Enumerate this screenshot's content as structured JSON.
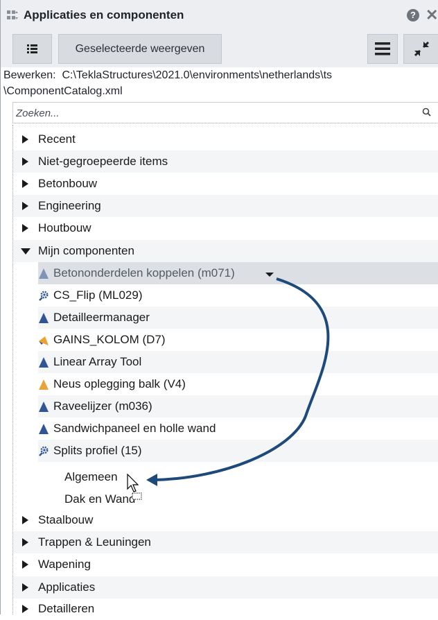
{
  "window": {
    "title": "Applicaties en componenten",
    "help_symbol": "?",
    "close_symbol": "✕"
  },
  "toolbar": {
    "list_icon": "list-icon",
    "selected_button_label": "Geselecteerde weergeven",
    "menu_icon": "hamburger-menu-icon",
    "collapse_icon": "collapse-arrows-icon"
  },
  "catalog_path": {
    "label": "Bewerken:",
    "path_line1": "C:\\TeklaStructures\\2021.0\\environments\\netherlands\\ts",
    "path_line2": "\\ComponentCatalog.xml"
  },
  "search": {
    "placeholder": "Zoeken...",
    "value": ""
  },
  "tree": {
    "groups_top": [
      {
        "label": "Recent"
      },
      {
        "label": "Niet-gegroepeerde items"
      },
      {
        "label": "Betonbouw"
      },
      {
        "label": "Engineering"
      },
      {
        "label": "Houtbouw"
      }
    ],
    "expanded_group": {
      "label": "Mijn componenten"
    },
    "components": [
      {
        "label": "Betononderdelen koppelen (m071)",
        "icon": "blue-component-icon",
        "selected": true
      },
      {
        "label": "CS_Flip (ML029)",
        "icon": "gear-component-icon"
      },
      {
        "label": "Detailleermanager",
        "icon": "blue-component-icon"
      },
      {
        "label": "GAINS_KOLOM (D7)",
        "icon": "orange-detail-icon"
      },
      {
        "label": "Linear Array Tool",
        "icon": "blue-component-icon"
      },
      {
        "label": "Neus oplegging balk (V4)",
        "icon": "orange-component-icon"
      },
      {
        "label": "Raveelijzer (m036)",
        "icon": "blue-component-icon"
      },
      {
        "label": "Sandwichpaneel en holle wand",
        "icon": "blue-component-icon"
      },
      {
        "label": "Splits profiel (15)",
        "icon": "gear-component-icon"
      }
    ],
    "subgroups": [
      {
        "label": "Algemeen"
      },
      {
        "label": "Dak en Wand"
      }
    ],
    "groups_bottom": [
      {
        "label": "Staalbouw"
      },
      {
        "label": "Trappen & Leuningen"
      },
      {
        "label": "Wapening"
      },
      {
        "label": "Applicaties"
      },
      {
        "label": "Detailleren"
      }
    ]
  },
  "colors": {
    "component_blue": "#2f5597",
    "component_orange": "#e8a33a",
    "detail_orange": "#f0a030",
    "gear_blue": "#2f5597",
    "drag_arrow": "#1d4a7a",
    "selection": "#dcdfe3"
  }
}
